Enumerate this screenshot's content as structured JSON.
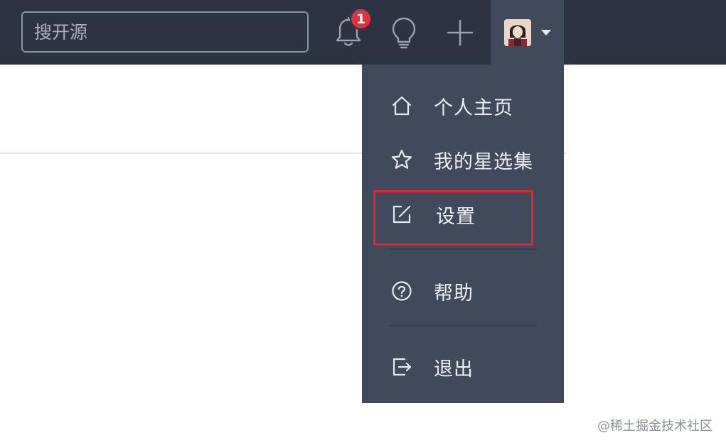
{
  "topbar": {
    "search": {
      "placeholder": "搜开源",
      "value": ""
    },
    "notifications": {
      "icon": "bell-icon",
      "badge_count": "1"
    },
    "ideas": {
      "icon": "lightbulb-icon"
    },
    "create": {
      "icon": "plus-icon"
    },
    "user": {
      "icon": "avatar",
      "caret": "chevron-down-icon"
    }
  },
  "user_menu": {
    "items": [
      {
        "label": "个人主页",
        "icon": "home-icon"
      },
      {
        "label": "我的星选集",
        "icon": "star-icon"
      },
      {
        "label": "设置",
        "icon": "edit-icon"
      },
      {
        "label": "帮助",
        "icon": "help-icon"
      },
      {
        "label": "退出",
        "icon": "logout-icon"
      }
    ]
  },
  "watermark": "@稀土掘金技术社区",
  "colors": {
    "topbar_bg": "#2c3343",
    "menu_bg": "#414a5d",
    "badge_red": "#e0333c",
    "highlight_red": "#e3262e"
  }
}
